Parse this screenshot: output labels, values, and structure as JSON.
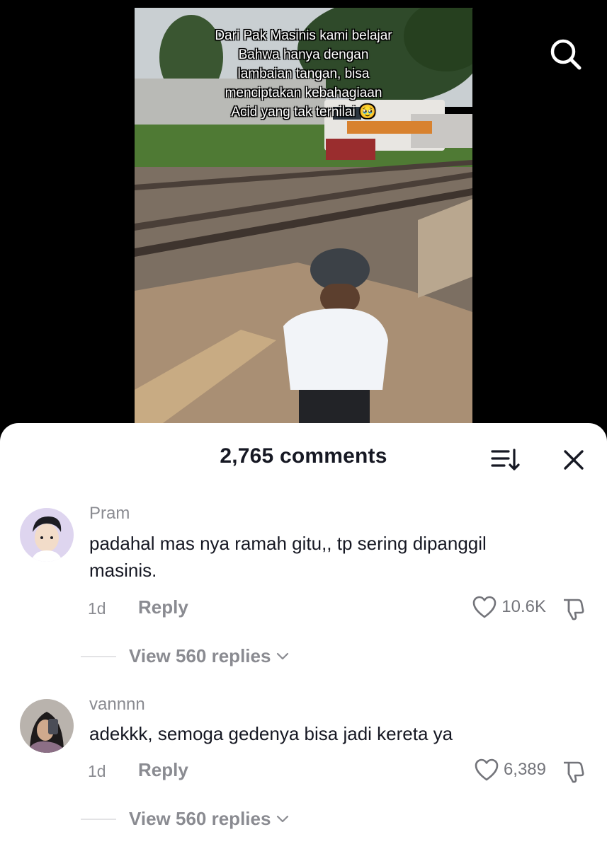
{
  "video": {
    "caption_lines": [
      "Dari Pak Masinis kami belajar",
      "Bahwa hanya dengan",
      "lambaian tangan, bisa",
      "menciptakan kebahagiaan",
      "Acid yang tak ternilai 🥹"
    ],
    "search_icon": "search-icon"
  },
  "comments_panel": {
    "title": "2,765 comments",
    "sort_icon": "sort-icon",
    "close_icon": "close-icon",
    "comments": [
      {
        "username": "Pram",
        "text": "padahal mas nya ramah gitu,, tp sering dipanggil masinis.",
        "time": "1d",
        "reply_label": "Reply",
        "likes": "10.6K",
        "view_replies": "View 560 replies"
      },
      {
        "username": "vannnn",
        "text": "adekkk, semoga gedenya bisa jadi kereta ya",
        "time": "1d",
        "reply_label": "Reply",
        "likes": "6,389",
        "view_replies": "View 560 replies"
      }
    ]
  },
  "colors": {
    "text_primary": "#161823",
    "text_secondary": "#8a8b91",
    "background": "#ffffff"
  }
}
